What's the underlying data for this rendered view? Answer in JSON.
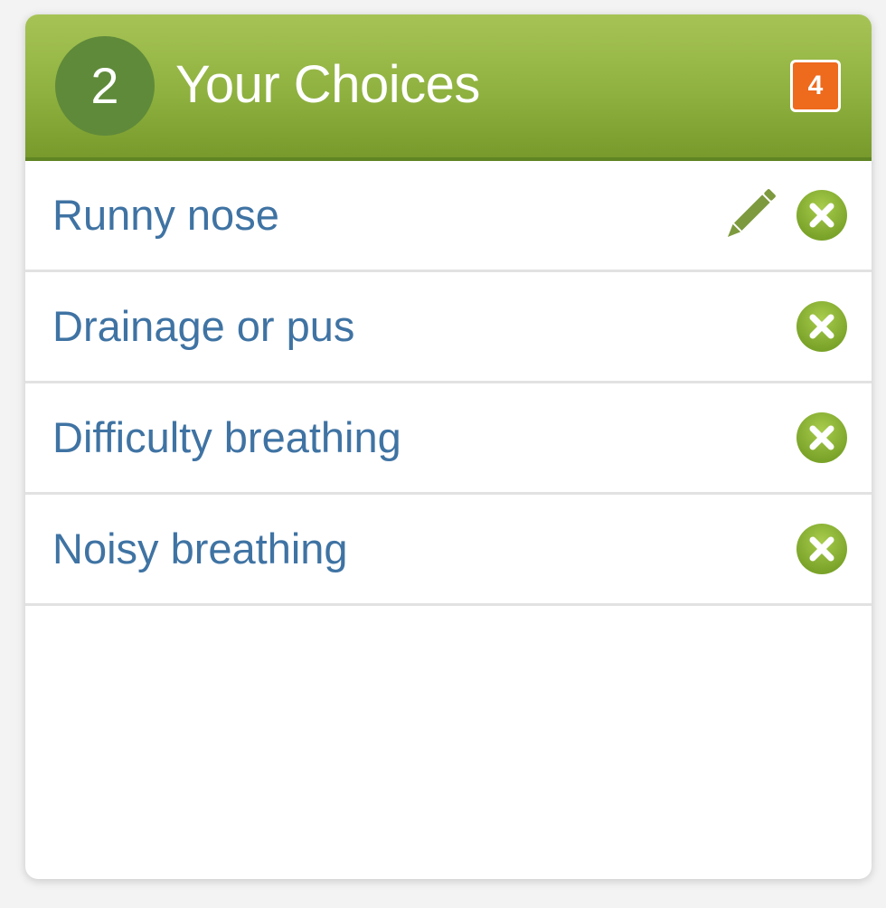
{
  "panel": {
    "step_number": "2",
    "title": "Your Choices",
    "count_badge": "4"
  },
  "choices": [
    {
      "label": "Runny nose",
      "editable": true
    },
    {
      "label": "Drainage or pus",
      "editable": false
    },
    {
      "label": "Difficulty breathing",
      "editable": false
    },
    {
      "label": "Noisy breathing",
      "editable": false
    }
  ],
  "icons": {
    "remove": "remove-icon",
    "edit": "pencil-icon"
  },
  "colors": {
    "header_green": "#8fb13f",
    "step_circle": "#5f8a3a",
    "badge_orange": "#ee6a1d",
    "link_blue": "#3f73a3",
    "remove_green": "#8cb530"
  }
}
